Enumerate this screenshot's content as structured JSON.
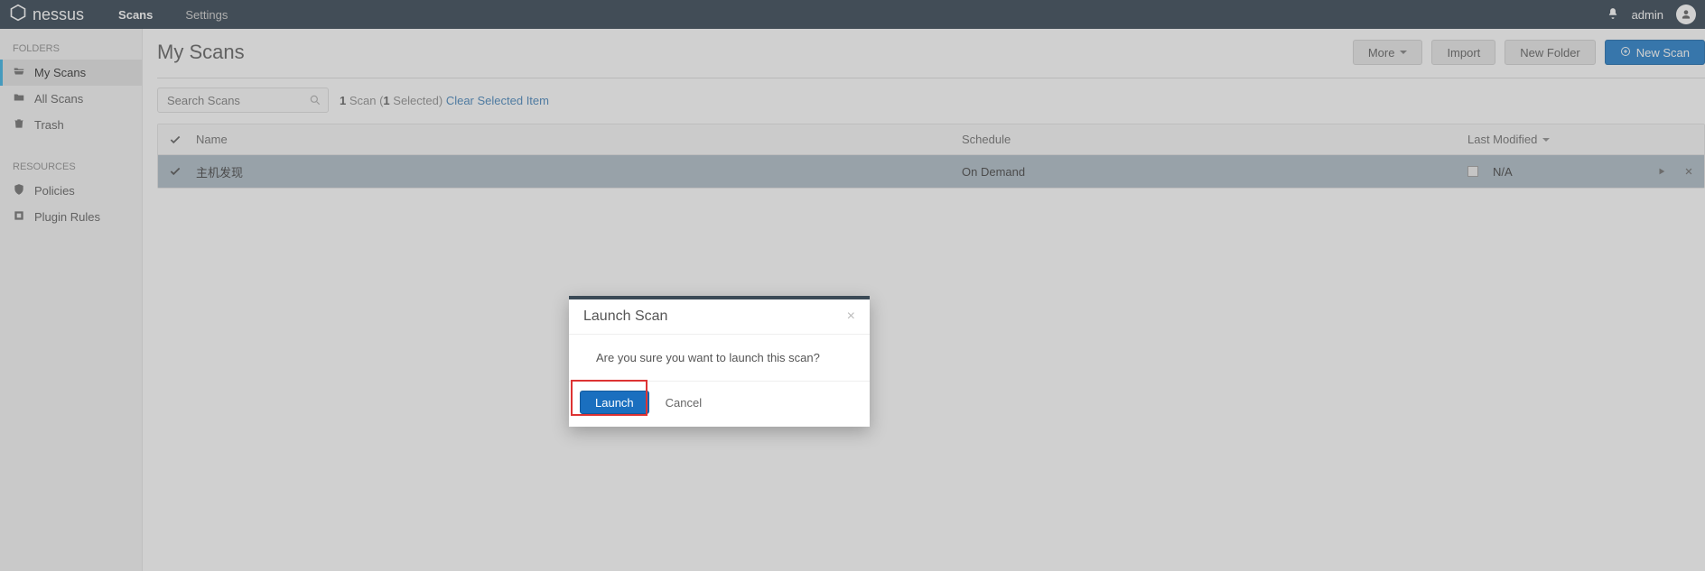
{
  "brand": "nessus",
  "nav": {
    "scans": "Scans",
    "settings": "Settings"
  },
  "user": {
    "name": "admin"
  },
  "sidebar": {
    "folders_head": "FOLDERS",
    "resources_head": "RESOURCES",
    "items": [
      {
        "label": "My Scans"
      },
      {
        "label": "All Scans"
      },
      {
        "label": "Trash"
      },
      {
        "label": "Policies"
      },
      {
        "label": "Plugin Rules"
      }
    ]
  },
  "page": {
    "title": "My Scans",
    "more": "More",
    "import": "Import",
    "new_folder": "New Folder",
    "new_scan": "New Scan"
  },
  "search": {
    "placeholder": "Search Scans"
  },
  "count": {
    "total": "1",
    "word": " Scan (",
    "selected": "1",
    "after": " Selected) ",
    "clear": "Clear Selected Item"
  },
  "cols": {
    "name": "Name",
    "schedule": "Schedule",
    "modified": "Last Modified"
  },
  "row": {
    "name": "主机发现",
    "schedule": "On Demand",
    "modified": "N/A"
  },
  "modal": {
    "title": "Launch Scan",
    "body": "Are you sure you want to launch this scan?",
    "launch": "Launch",
    "cancel": "Cancel"
  }
}
